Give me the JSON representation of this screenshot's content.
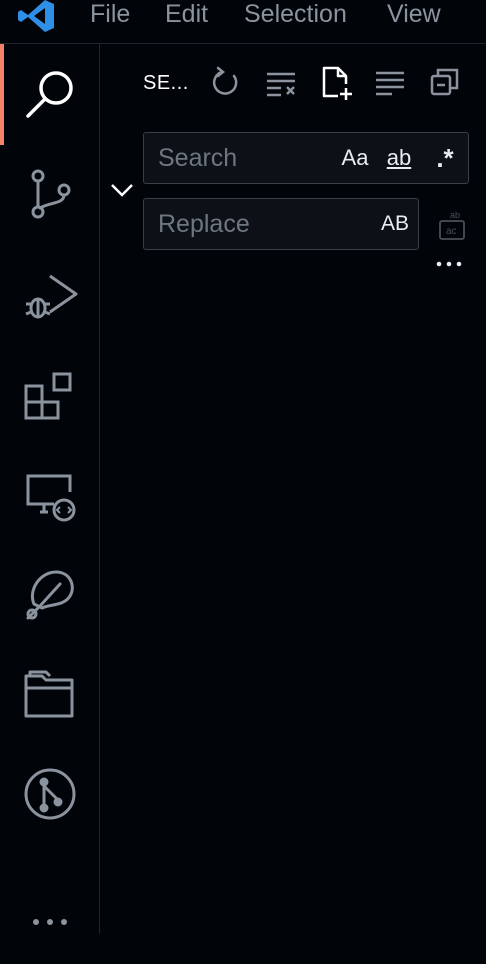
{
  "menubar": {
    "logo_icon": "vscode-logo-icon",
    "items": [
      "File",
      "Edit",
      "Selection",
      "View"
    ]
  },
  "activity_bar": {
    "active_accent": "#f78166",
    "icons": [
      "search-icon",
      "source-control-icon",
      "run-debug-icon",
      "extensions-icon",
      "remote-explorer-icon",
      "testing-icon",
      "folder-icon",
      "git-graph-icon",
      "more-icon"
    ]
  },
  "search_view": {
    "title": "SE...",
    "actions": [
      "refresh-icon",
      "clear-results-icon",
      "new-search-editor-icon",
      "view-as-tree-icon",
      "collapse-all-icon"
    ],
    "search": {
      "placeholder": "Search",
      "match_case": "Aa",
      "whole_word": "ab",
      "regex": ".*"
    },
    "replace": {
      "placeholder": "Replace",
      "preserve_case": "AB"
    }
  }
}
